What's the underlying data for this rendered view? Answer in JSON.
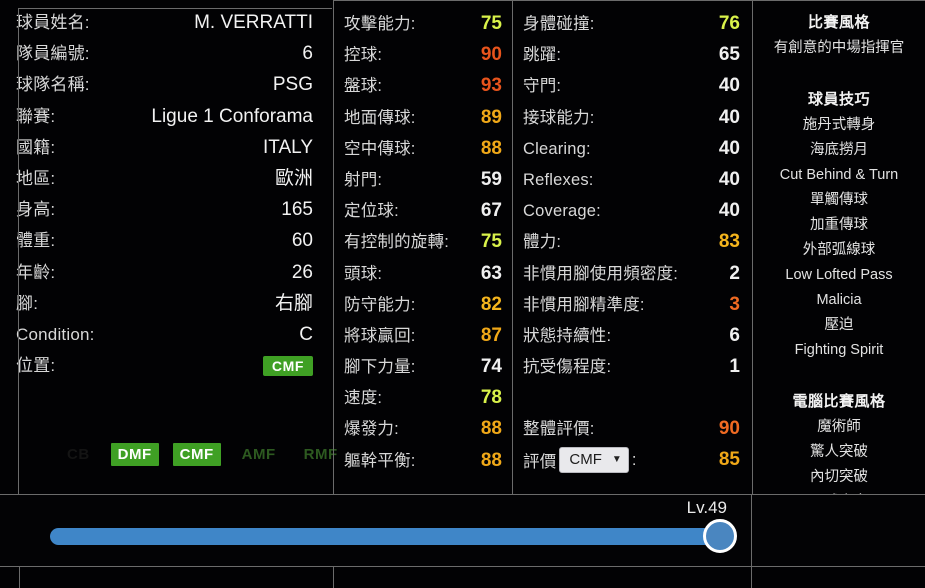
{
  "bio": {
    "rows": [
      {
        "label": "球員姓名:",
        "value": "M. VERRATTI"
      },
      {
        "label": "隊員編號:",
        "value": "6"
      },
      {
        "label": "球隊名稱:",
        "value": "PSG"
      },
      {
        "label": "聯賽:",
        "value": "Ligue 1 Conforama"
      },
      {
        "label": "國籍:",
        "value": "ITALY"
      },
      {
        "label": "地區:",
        "value": "歐洲"
      },
      {
        "label": "身高:",
        "value": "165"
      },
      {
        "label": "體重:",
        "value": "60"
      },
      {
        "label": "年齡:",
        "value": "26"
      },
      {
        "label": "腳:",
        "value": "右腳"
      },
      {
        "label": "Condition:",
        "value": "C"
      }
    ],
    "position_label": "位置:",
    "position_value": "CMF",
    "position_chips": [
      {
        "label": "CB",
        "state": "ghost"
      },
      {
        "label": "DMF",
        "state": "on"
      },
      {
        "label": "CMF",
        "state": "on"
      },
      {
        "label": "AMF",
        "state": "off"
      },
      {
        "label": "RMF",
        "state": "off"
      }
    ]
  },
  "attack_column": [
    {
      "label": "攻擊能力:",
      "value": "75",
      "color": "v-yellow"
    },
    {
      "label": "控球:",
      "value": "90",
      "color": "v-red"
    },
    {
      "label": "盤球:",
      "value": "93",
      "color": "v-red"
    },
    {
      "label": "地面傳球:",
      "value": "89",
      "color": "v-gold"
    },
    {
      "label": "空中傳球:",
      "value": "88",
      "color": "v-gold"
    },
    {
      "label": "射門:",
      "value": "59",
      "color": "v-white"
    },
    {
      "label": "定位球:",
      "value": "67",
      "color": "v-white"
    },
    {
      "label": "有控制的旋轉:",
      "value": "75",
      "color": "v-yellow"
    },
    {
      "label": "頭球:",
      "value": "63",
      "color": "v-white"
    },
    {
      "label": "防守能力:",
      "value": "82",
      "color": "v-amber"
    },
    {
      "label": "將球贏回:",
      "value": "87",
      "color": "v-gold"
    },
    {
      "label": "腳下力量:",
      "value": "74",
      "color": "v-white"
    },
    {
      "label": "速度:",
      "value": "78",
      "color": "v-yellow"
    },
    {
      "label": "爆發力:",
      "value": "88",
      "color": "v-gold"
    },
    {
      "label": "軀幹平衡:",
      "value": "88",
      "color": "v-gold"
    }
  ],
  "physical_column": [
    {
      "label": "身體碰撞:",
      "value": "76",
      "color": "v-yellow"
    },
    {
      "label": "跳躍:",
      "value": "65",
      "color": "v-white"
    },
    {
      "label": "守門:",
      "value": "40",
      "color": "v-white"
    },
    {
      "label": "接球能力:",
      "value": "40",
      "color": "v-white"
    },
    {
      "label": "Clearing:",
      "value": "40",
      "color": "v-white"
    },
    {
      "label": "Reflexes:",
      "value": "40",
      "color": "v-white"
    },
    {
      "label": "Coverage:",
      "value": "40",
      "color": "v-white"
    },
    {
      "label": "體力:",
      "value": "83",
      "color": "v-amber"
    },
    {
      "label": "非慣用腳使用頻密度:",
      "value": "2",
      "color": "v-white"
    },
    {
      "label": "非慣用腳精準度:",
      "value": "3",
      "color": "v-orange"
    },
    {
      "label": "狀態持續性:",
      "value": "6",
      "color": "v-white"
    },
    {
      "label": "抗受傷程度:",
      "value": "1",
      "color": "v-white"
    }
  ],
  "overall": {
    "label": "整體評價:",
    "value": "90",
    "color": "v-orange"
  },
  "rating": {
    "label": "評價",
    "suffix": ":",
    "dropdown_value": "CMF",
    "dropdown_caret": "▼",
    "value": "85",
    "color": "v-gold"
  },
  "styles": {
    "playing_style_title": "比賽風格",
    "playing_style_items": [
      "有創意的中場指揮官"
    ],
    "player_skills_title": "球員技巧",
    "player_skills_items": [
      "施丹式轉身",
      "海底撈月",
      "Cut Behind & Turn",
      "單觸傳球",
      "加重傳球",
      "外部弧線球",
      "Low Lofted Pass",
      "Malicia",
      "壓迫",
      "Fighting Spirit"
    ],
    "com_style_title": "電腦比賽風格",
    "com_style_items": [
      "魔術師",
      "驚人突破",
      "內切突破",
      "長球專家"
    ]
  },
  "slider": {
    "level_label": "Lv.49",
    "fill_percent": 100,
    "track_color": "#3f86c8",
    "knob_color": "#4a86c0"
  },
  "theme": {
    "background": "#020204",
    "border": "#6b6b6b",
    "badge_green": "#3fa024",
    "accent_red": "#e8541c",
    "accent_gold": "#f0a818",
    "accent_yellow": "#d9f24a"
  }
}
